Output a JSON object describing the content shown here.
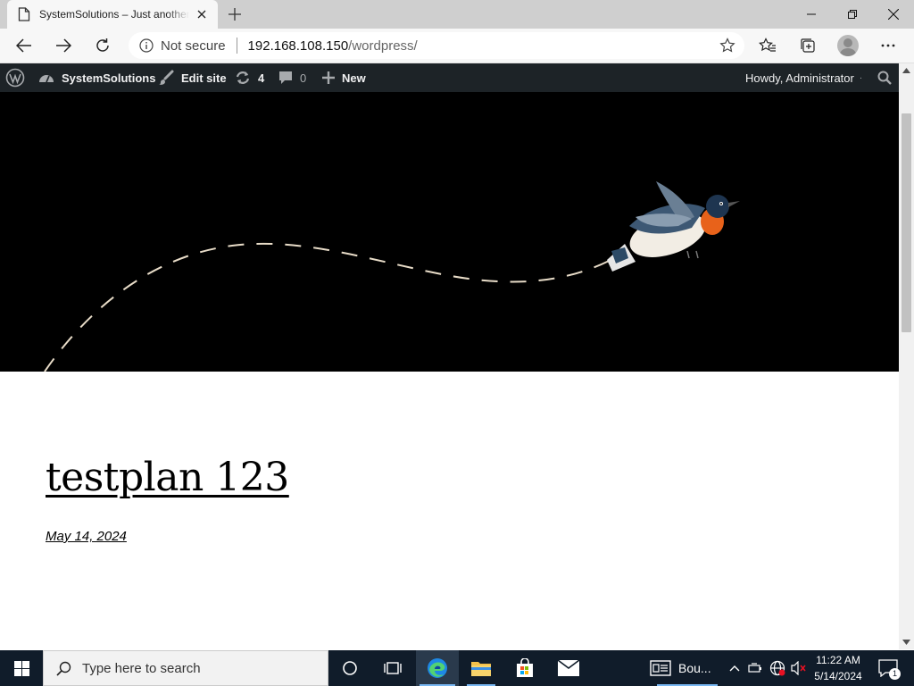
{
  "browser": {
    "tab_title": "SystemSolutions – Just another WordPress site",
    "address": {
      "security_label": "Not secure",
      "host": "192.168.108.150",
      "path": "/wordpress/"
    }
  },
  "admin_bar": {
    "site_name": "SystemSolutions",
    "edit_site": "Edit site",
    "updates_count": "4",
    "comments_count": "0",
    "new_label": "New",
    "greeting": "Howdy, Administrator"
  },
  "post": {
    "title": "testplan 123",
    "date": "May 14, 2024"
  },
  "taskbar": {
    "search_placeholder": "Type here to search",
    "app_label": "Bou...",
    "time": "11:22 AM",
    "date": "5/14/2024",
    "notification_count": "1"
  },
  "icons": {
    "tab": "page-icon",
    "admin_bar": [
      "wordpress-logo-icon",
      "dashboard-icon",
      "brush-icon",
      "updates-icon",
      "comment-icon",
      "plus-icon",
      "search-icon"
    ],
    "taskbar": [
      "windows-start-icon",
      "cortana-icon",
      "task-view-icon",
      "edge-icon",
      "file-explorer-icon",
      "store-icon",
      "mail-icon"
    ]
  },
  "colors": {
    "admin_bar_bg": "#1d2327",
    "taskbar_bg": "#101c2a",
    "hero_bg": "#000000",
    "bird_breast": "#e8621a"
  }
}
